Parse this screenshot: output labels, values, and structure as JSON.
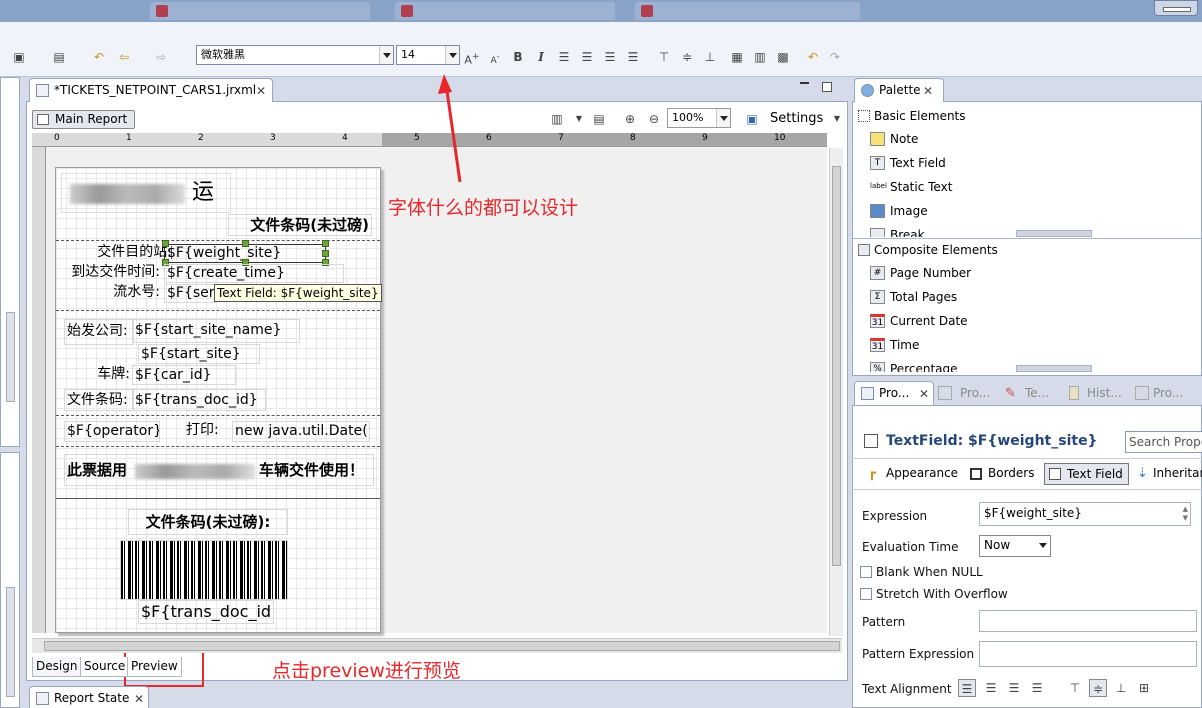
{
  "window": {
    "tabs": [
      "",
      ""
    ]
  },
  "toolbar": {
    "font_name": "微软雅黑",
    "font_size": "14"
  },
  "editor": {
    "tab_label": "*TICKETS_NETPOINT_CARS1.jrxml",
    "main_report_label": "Main Report",
    "zoom": "100%",
    "settings_label": "Settings",
    "ruler_ticks": [
      "0",
      "1",
      "2",
      "3",
      "4",
      "5",
      "6",
      "7",
      "8",
      "9",
      "10"
    ],
    "bottom_tabs": [
      "Design",
      "Source",
      "Preview"
    ]
  },
  "report": {
    "title_suffix": "运",
    "barcode_heading": "文件条码(未过磅)",
    "label_dest": "交件目的站:",
    "field_weight_site": "$F{weight_site}",
    "label_arrive_time": "到达交件时间:",
    "field_create_time": "$F{create_time}",
    "label_serial": "流水号:",
    "field_serial": "$F{seria",
    "label_origin": "始发公司:",
    "field_start_site_name": "$F{start_site_name}",
    "field_start_site": "$F{start_site}",
    "label_plate": "车牌:",
    "field_car_id": "$F{car_id}",
    "label_doc_code": "文件条码:",
    "field_trans_doc_id": "$F{trans_doc_id}",
    "field_operator": "$F{operator}",
    "label_print": "打印:",
    "field_date": "new java.util.Date()",
    "notice_prefix": "此票据用",
    "notice_suffix": "车辆交件使用！",
    "barcode_label": "文件条码(未过磅):",
    "barcode_text": "$F{trans_doc_id}"
  },
  "tooltip": "Text Field: $F{weight_site}",
  "annotations": {
    "font_hint": "字体什么的都可以设计",
    "preview_hint": "点击preview进行预览"
  },
  "palette": {
    "tab_label": "Palette",
    "group_basic": "Basic Elements",
    "basic_items": [
      "Note",
      "Text Field",
      "Static Text",
      "Image",
      "Break"
    ],
    "group_composite": "Composite Elements",
    "composite_items": [
      "Page Number",
      "Total Pages",
      "Current Date",
      "Time",
      "Percentage"
    ]
  },
  "properties": {
    "tabs": [
      "Pro...",
      "Pro...",
      "Te...",
      "Hist...",
      "Pro..."
    ],
    "title": "TextField: $F{weight_site}",
    "search_placeholder": "Search Prope",
    "subtabs": [
      "Appearance",
      "Borders",
      "Text Field",
      "Inheritan"
    ],
    "expression_label": "Expression",
    "expression_value": "$F{weight_site}",
    "evaluation_time_label": "Evaluation Time",
    "evaluation_time_value": "Now",
    "blank_when_null_label": "Blank When NULL",
    "stretch_overflow_label": "Stretch With Overflow",
    "pattern_label": "Pattern",
    "pattern_expression_label": "Pattern Expression",
    "text_alignment_label": "Text Alignment"
  },
  "report_state": {
    "tab_label": "Report State"
  }
}
